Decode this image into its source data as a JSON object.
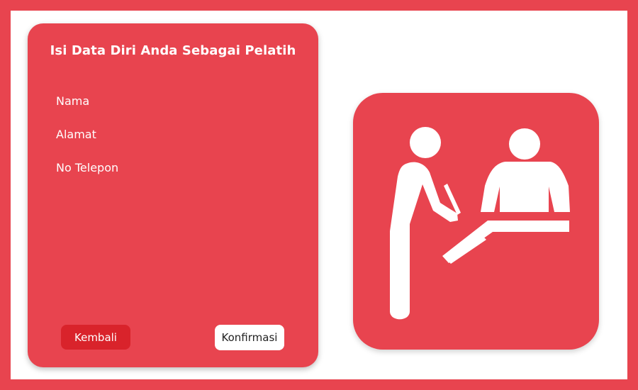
{
  "form": {
    "title": "Isi Data Diri Anda Sebagai Pelatih",
    "fields": [
      {
        "label": "Nama"
      },
      {
        "label": "Alamat"
      },
      {
        "label": "No Telepon"
      }
    ],
    "back_label": "Kembali",
    "confirm_label": "Konfirmasi"
  },
  "illustration": {
    "icon": "registration-desk-icon"
  },
  "colors": {
    "primary": "#e8444f",
    "button_back": "#d9232b",
    "white": "#ffffff"
  }
}
